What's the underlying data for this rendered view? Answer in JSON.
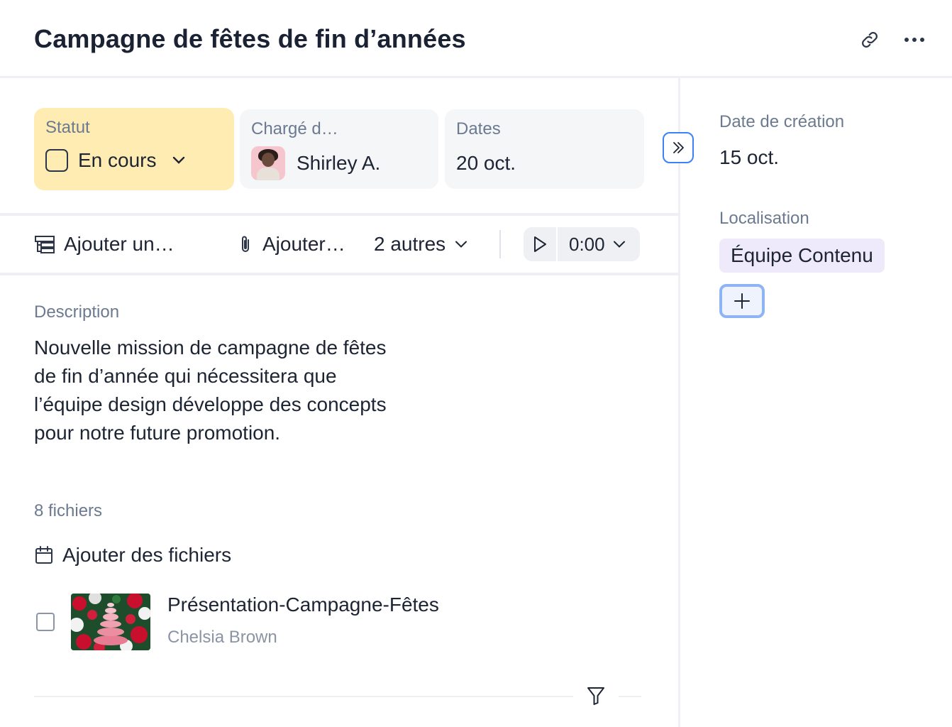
{
  "header": {
    "title": "Campagne de fêtes de fin d’années",
    "link_icon": "link-icon",
    "more_icon": "more-horizontal-icon"
  },
  "fields": {
    "status": {
      "label": "Statut",
      "value": "En cours"
    },
    "assignee": {
      "label": "Chargé d…",
      "value": "Shirley A."
    },
    "dates": {
      "label": "Dates",
      "value": "20 oct."
    }
  },
  "toolbar": {
    "add_subtask": "Ajouter un…",
    "add_attachment": "Ajouter…",
    "others": "2 autres",
    "timer": "0:00"
  },
  "description": {
    "label": "Description",
    "text": "Nouvelle mission de campagne de fêtes de fin d’année qui nécessitera que l’équipe design développe des concepts pour notre future promotion."
  },
  "files": {
    "count_label": "8 fichiers",
    "add_label": "Ajouter des fichiers",
    "items": [
      {
        "name": "Présentation-Campagne-Fêtes",
        "owner": "Chelsia Brown"
      }
    ]
  },
  "sidebar": {
    "created_label": "Date de création",
    "created_value": "15 oct.",
    "location_label": "Localisation",
    "location_value": "Équipe Contenu"
  },
  "colors": {
    "status_bg": "#ffecb3",
    "accent_blue": "#3b82f6",
    "location_chip": "#eee9fb",
    "text_primary": "#1d2433",
    "text_muted": "#6b7a90"
  }
}
